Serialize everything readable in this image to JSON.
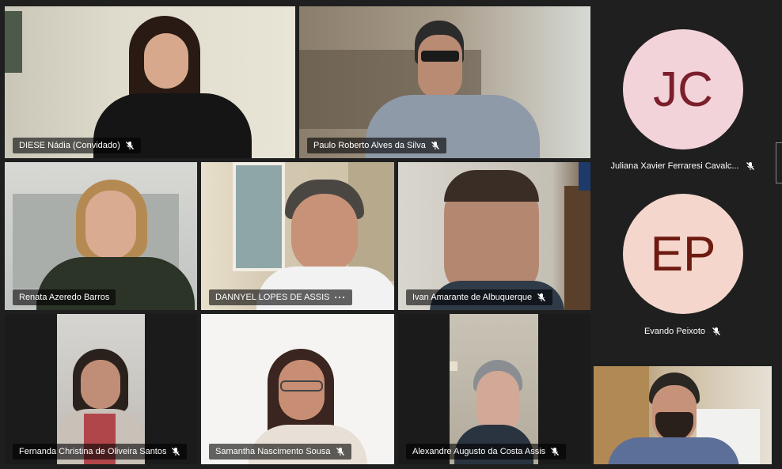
{
  "participants": [
    {
      "name": "DIESE Nádia (Convidado)",
      "muted": true
    },
    {
      "name": "Paulo Roberto Alves da Silva",
      "muted": true
    },
    {
      "name": "Renata Azeredo Barros",
      "muted": false
    },
    {
      "name": "DANNYEL LOPES DE ASSIS",
      "muted": false,
      "more": "···"
    },
    {
      "name": "Ivan Amarante de Albuquerque",
      "muted": true
    },
    {
      "name": "Fernanda Christina de Oliveira Santos",
      "muted": true
    },
    {
      "name": "Samantha Nascimento Sousa",
      "muted": true
    },
    {
      "name": "Alexandre Augusto da Costa Assis",
      "muted": true
    }
  ],
  "side_panel": {
    "avatar_1": {
      "initials": "JC",
      "name": "Juliana Xavier Ferraresi Cavalc...",
      "bg": "#f2d3d9",
      "fg": "#7a1f2b"
    },
    "avatar_2": {
      "initials": "EP",
      "name": "Evando Peixoto",
      "bg": "#f5d6cc",
      "fg": "#6e1a10"
    }
  },
  "icons": {
    "mic_muted": "mic-muted-icon",
    "more": "more-options-icon"
  },
  "colors": {
    "background": "#1f1f1f",
    "label_bg": "rgba(0,0,0,0.6)"
  }
}
